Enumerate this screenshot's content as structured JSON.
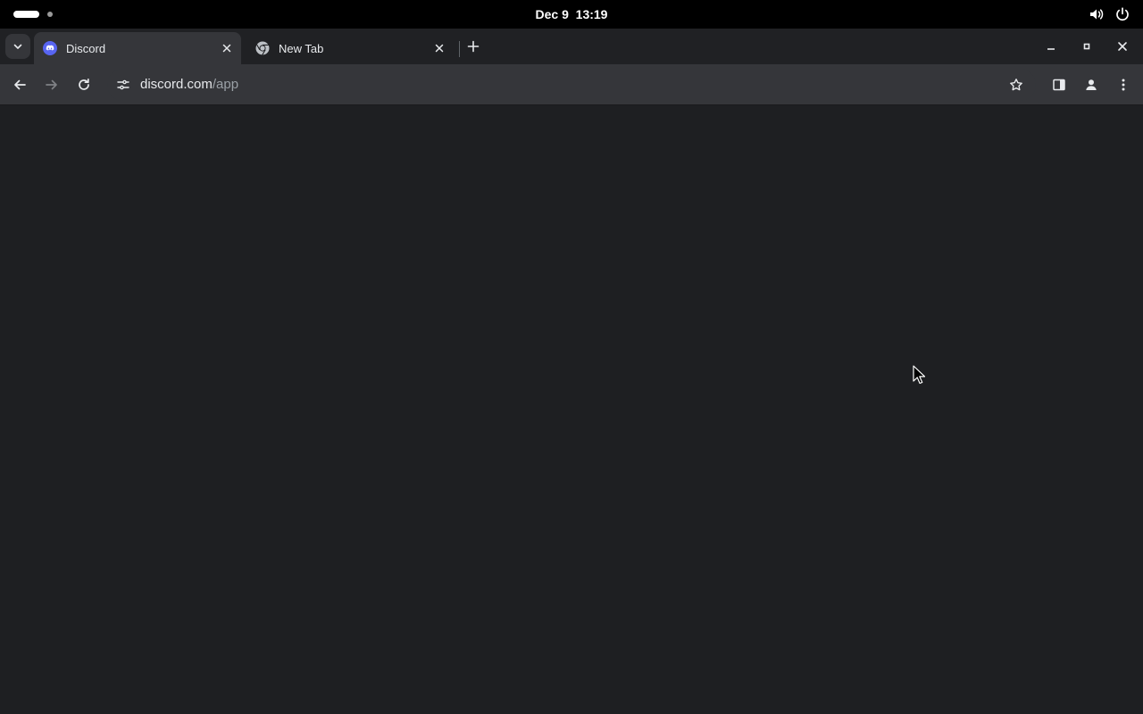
{
  "system": {
    "clock": {
      "date": "Dec 9",
      "time": "13:19"
    },
    "tray_icons": [
      "volume-icon",
      "power-icon"
    ]
  },
  "browser": {
    "tabs": [
      {
        "title": "Discord",
        "favicon": "discord-icon",
        "active": true
      },
      {
        "title": "New Tab",
        "favicon": "chrome-icon",
        "active": false
      }
    ],
    "address": {
      "host": "discord.com",
      "path": "/app"
    },
    "toolbar_icons": [
      "back-icon",
      "forward-icon",
      "reload-icon",
      "site-info-icon",
      "bookmark-star-icon",
      "side-panel-icon",
      "profile-icon",
      "menu-icon"
    ]
  },
  "page": {
    "background": "#1e1f22"
  },
  "colors": {
    "discord_blurple": "#5865f2",
    "chrome_dark_frame": "#202124",
    "chrome_dark_toolbar": "#35363a"
  }
}
